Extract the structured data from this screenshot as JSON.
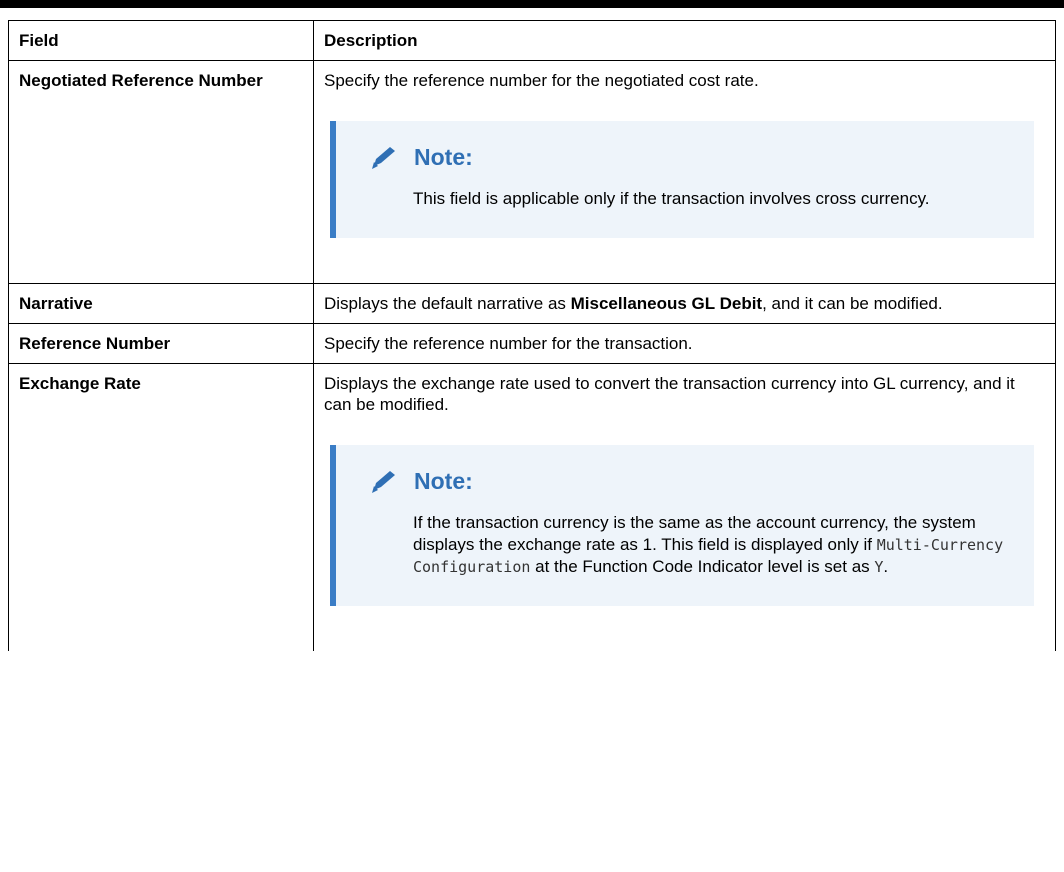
{
  "header": {
    "field": "Field",
    "description": "Description"
  },
  "rows": [
    {
      "field": "Negotiated Reference Number",
      "description": "Specify the reference number for the negotiated cost rate.",
      "note": {
        "title": "Note:",
        "text": "This field is applicable only if the transaction involves cross currency."
      }
    },
    {
      "field": "Narrative",
      "description_prefix": "Displays the default narrative as ",
      "description_bold": "Miscellaneous GL Debit",
      "description_suffix": ", and it can be modified."
    },
    {
      "field": "Reference Number",
      "description": "Specify the reference number for the transaction."
    },
    {
      "field": "Exchange Rate",
      "description": "Displays the exchange rate used to convert the transaction currency into GL currency, and it can be modified.",
      "note": {
        "title": "Note:",
        "line1": "If the transaction currency is the same as the account currency, the system displays the exchange rate as 1.",
        "line2_prefix": "This field is displayed only if ",
        "line2_code": "Multi-Currency Configuration",
        "line2_mid": " at the Function Code Indicator level is set as ",
        "line2_value": "Y",
        "line2_suffix": "."
      }
    }
  ],
  "icons": {
    "note_icon": "pencil-icon",
    "note_color": "#2f6fb4",
    "note_background": "#eef4fa",
    "note_border": "#3a7dc6"
  }
}
